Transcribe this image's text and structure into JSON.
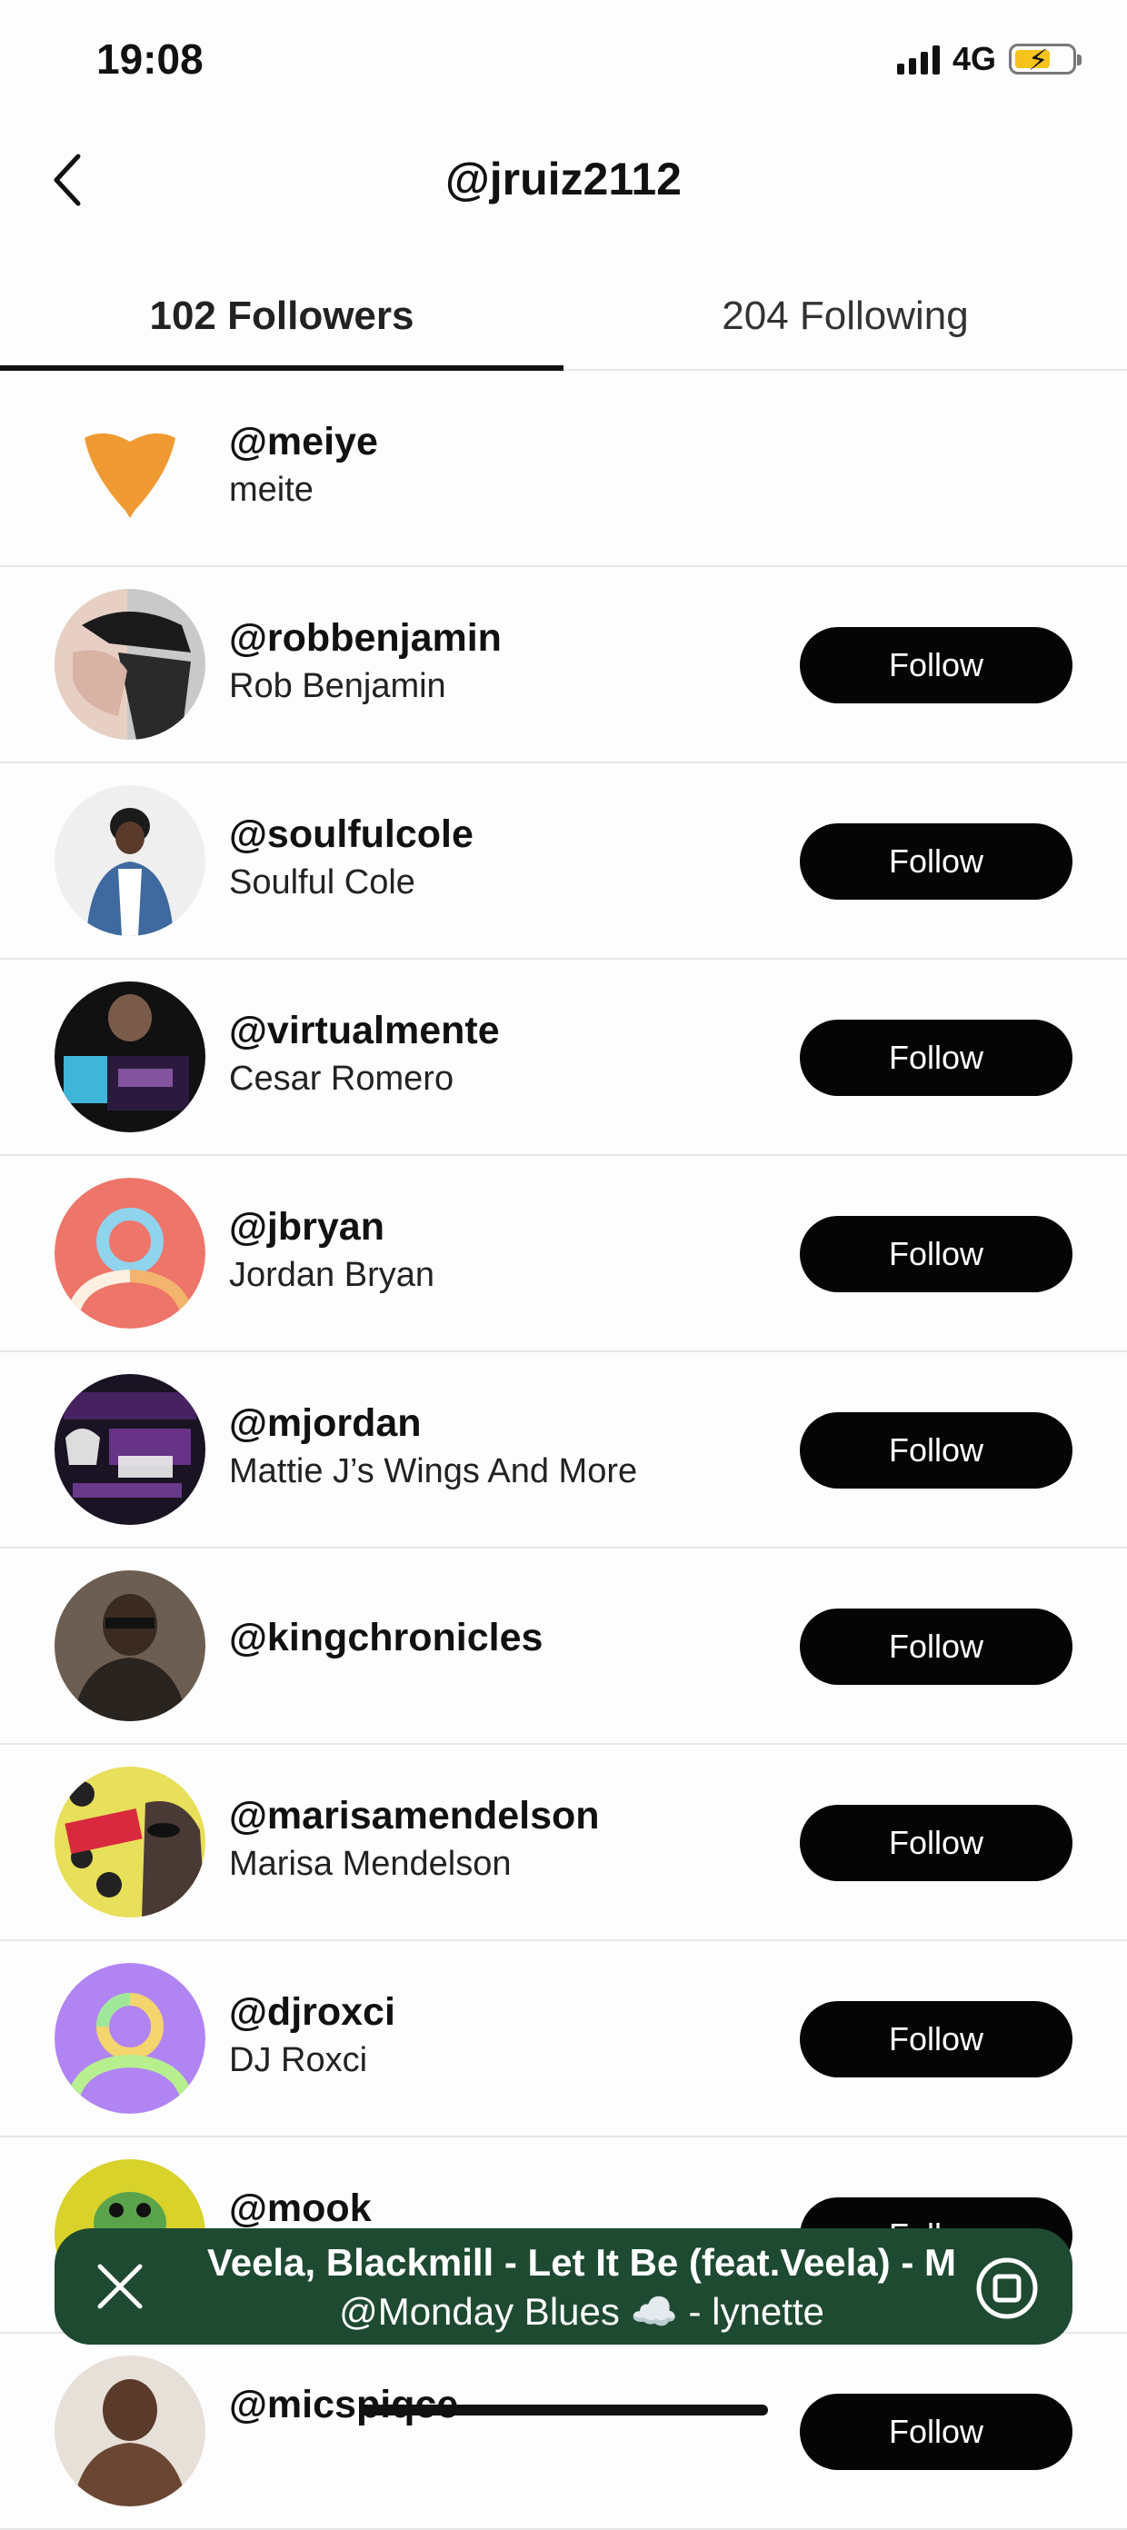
{
  "status_bar": {
    "time": "19:08",
    "network": "4G"
  },
  "header": {
    "title": "@jruiz2112"
  },
  "tabs": {
    "followers": "102 Followers",
    "following": "204 Following"
  },
  "follow_label": "Follow",
  "users": [
    {
      "handle": "@meiye",
      "name": "meite",
      "avatar": "orange-flower-avatar",
      "follow": false
    },
    {
      "handle": "@robbenjamin",
      "name": "Rob Benjamin",
      "avatar": "photo-avatar",
      "follow": true
    },
    {
      "handle": "@soulfulcole",
      "name": "Soulful Cole",
      "avatar": "photo-avatar",
      "follow": true
    },
    {
      "handle": "@virtualmente",
      "name": "Cesar Romero",
      "avatar": "photo-avatar",
      "follow": true
    },
    {
      "handle": "@jbryan",
      "name": "Jordan Bryan",
      "avatar": "default-avatar-red",
      "follow": true
    },
    {
      "handle": "@mjordan",
      "name": "Mattie J’s Wings And More",
      "avatar": "photo-avatar",
      "follow": true
    },
    {
      "handle": "@kingchronicles",
      "name": "",
      "avatar": "photo-avatar",
      "follow": true
    },
    {
      "handle": "@marisamendelson",
      "name": "Marisa Mendelson",
      "avatar": "photo-avatar",
      "follow": true
    },
    {
      "handle": "@djroxci",
      "name": "DJ Roxci",
      "avatar": "default-avatar-purple",
      "follow": true
    },
    {
      "handle": "@mook",
      "name": "",
      "avatar": "photo-avatar",
      "follow": true
    },
    {
      "handle": "@micspiqce",
      "name": "",
      "avatar": "photo-avatar",
      "follow": true
    }
  ],
  "player": {
    "track": "Veela, Blackmill - Let It Be (feat.Veela) - M",
    "subtitle": "@Monday Blues ☁️ - lynette"
  },
  "colors": {
    "player_bg": "#1e4a31",
    "follow_bg": "#050505",
    "default_avatar_red": "#ee7569",
    "default_avatar_purple": "#b184f3"
  }
}
